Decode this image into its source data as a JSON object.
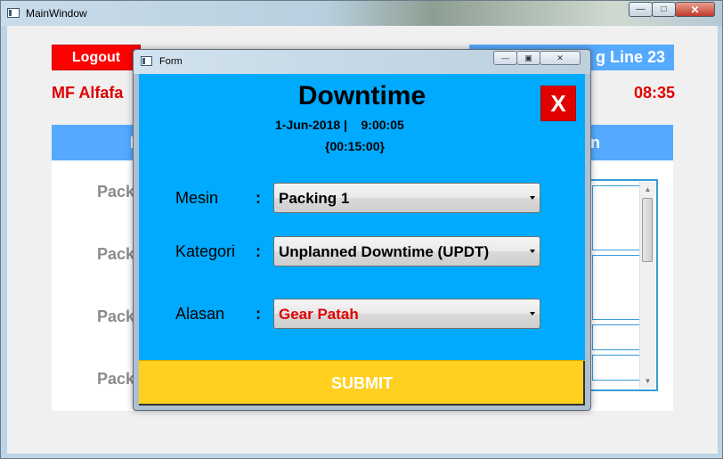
{
  "main_window": {
    "title": "MainWindow",
    "logout_label": "Logout",
    "line_label": "g Line 23",
    "user_name": "MF Alfafa",
    "clock": "08:35",
    "table_header_left": "I",
    "table_header_right": "n",
    "rows": [
      "Pack",
      "Pack",
      "Pack",
      "Pack"
    ]
  },
  "dialog": {
    "title": "Form",
    "heading": "Downtime",
    "datetime": "1-Jun-2018 |    9:00:05",
    "duration": "{00:15:00}",
    "close_label": "X",
    "fields": {
      "mesin": {
        "label": "Mesin",
        "value": "Packing 1"
      },
      "kategori": {
        "label": "Kategori",
        "value": "Unplanned Downtime (UPDT)"
      },
      "alasan": {
        "label": "Alasan",
        "value": "Gear Patah"
      }
    },
    "colon": ":",
    "submit_label": "SUBMIT"
  },
  "colors": {
    "dialog_bg": "#00aaff",
    "logout_bg": "#ff0000",
    "submit_bg": "#ffd020",
    "header_bg": "#55aaff",
    "alert_text": "#e00000"
  }
}
